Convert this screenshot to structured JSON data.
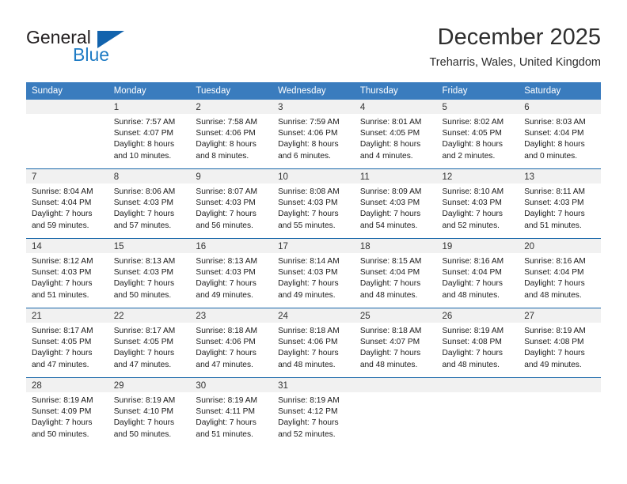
{
  "brand": {
    "name_part1": "General",
    "name_part2": "Blue",
    "accent_color": "#1263ad",
    "text_color": "#231f20"
  },
  "header": {
    "month_title": "December 2025",
    "location": "Treharris, Wales, United Kingdom"
  },
  "calendar": {
    "header_bg": "#3a7cbe",
    "daynum_bg": "#f1f1f1",
    "separator_color": "#1565a8",
    "weekdays": [
      "Sunday",
      "Monday",
      "Tuesday",
      "Wednesday",
      "Thursday",
      "Friday",
      "Saturday"
    ],
    "weeks": [
      {
        "days": [
          {
            "num": "",
            "sunrise": "",
            "sunset": "",
            "daylight_1": "",
            "daylight_2": ""
          },
          {
            "num": "1",
            "sunrise": "Sunrise: 7:57 AM",
            "sunset": "Sunset: 4:07 PM",
            "daylight_1": "Daylight: 8 hours",
            "daylight_2": "and 10 minutes."
          },
          {
            "num": "2",
            "sunrise": "Sunrise: 7:58 AM",
            "sunset": "Sunset: 4:06 PM",
            "daylight_1": "Daylight: 8 hours",
            "daylight_2": "and 8 minutes."
          },
          {
            "num": "3",
            "sunrise": "Sunrise: 7:59 AM",
            "sunset": "Sunset: 4:06 PM",
            "daylight_1": "Daylight: 8 hours",
            "daylight_2": "and 6 minutes."
          },
          {
            "num": "4",
            "sunrise": "Sunrise: 8:01 AM",
            "sunset": "Sunset: 4:05 PM",
            "daylight_1": "Daylight: 8 hours",
            "daylight_2": "and 4 minutes."
          },
          {
            "num": "5",
            "sunrise": "Sunrise: 8:02 AM",
            "sunset": "Sunset: 4:05 PM",
            "daylight_1": "Daylight: 8 hours",
            "daylight_2": "and 2 minutes."
          },
          {
            "num": "6",
            "sunrise": "Sunrise: 8:03 AM",
            "sunset": "Sunset: 4:04 PM",
            "daylight_1": "Daylight: 8 hours",
            "daylight_2": "and 0 minutes."
          }
        ]
      },
      {
        "days": [
          {
            "num": "7",
            "sunrise": "Sunrise: 8:04 AM",
            "sunset": "Sunset: 4:04 PM",
            "daylight_1": "Daylight: 7 hours",
            "daylight_2": "and 59 minutes."
          },
          {
            "num": "8",
            "sunrise": "Sunrise: 8:06 AM",
            "sunset": "Sunset: 4:03 PM",
            "daylight_1": "Daylight: 7 hours",
            "daylight_2": "and 57 minutes."
          },
          {
            "num": "9",
            "sunrise": "Sunrise: 8:07 AM",
            "sunset": "Sunset: 4:03 PM",
            "daylight_1": "Daylight: 7 hours",
            "daylight_2": "and 56 minutes."
          },
          {
            "num": "10",
            "sunrise": "Sunrise: 8:08 AM",
            "sunset": "Sunset: 4:03 PM",
            "daylight_1": "Daylight: 7 hours",
            "daylight_2": "and 55 minutes."
          },
          {
            "num": "11",
            "sunrise": "Sunrise: 8:09 AM",
            "sunset": "Sunset: 4:03 PM",
            "daylight_1": "Daylight: 7 hours",
            "daylight_2": "and 54 minutes."
          },
          {
            "num": "12",
            "sunrise": "Sunrise: 8:10 AM",
            "sunset": "Sunset: 4:03 PM",
            "daylight_1": "Daylight: 7 hours",
            "daylight_2": "and 52 minutes."
          },
          {
            "num": "13",
            "sunrise": "Sunrise: 8:11 AM",
            "sunset": "Sunset: 4:03 PM",
            "daylight_1": "Daylight: 7 hours",
            "daylight_2": "and 51 minutes."
          }
        ]
      },
      {
        "days": [
          {
            "num": "14",
            "sunrise": "Sunrise: 8:12 AM",
            "sunset": "Sunset: 4:03 PM",
            "daylight_1": "Daylight: 7 hours",
            "daylight_2": "and 51 minutes."
          },
          {
            "num": "15",
            "sunrise": "Sunrise: 8:13 AM",
            "sunset": "Sunset: 4:03 PM",
            "daylight_1": "Daylight: 7 hours",
            "daylight_2": "and 50 minutes."
          },
          {
            "num": "16",
            "sunrise": "Sunrise: 8:13 AM",
            "sunset": "Sunset: 4:03 PM",
            "daylight_1": "Daylight: 7 hours",
            "daylight_2": "and 49 minutes."
          },
          {
            "num": "17",
            "sunrise": "Sunrise: 8:14 AM",
            "sunset": "Sunset: 4:03 PM",
            "daylight_1": "Daylight: 7 hours",
            "daylight_2": "and 49 minutes."
          },
          {
            "num": "18",
            "sunrise": "Sunrise: 8:15 AM",
            "sunset": "Sunset: 4:04 PM",
            "daylight_1": "Daylight: 7 hours",
            "daylight_2": "and 48 minutes."
          },
          {
            "num": "19",
            "sunrise": "Sunrise: 8:16 AM",
            "sunset": "Sunset: 4:04 PM",
            "daylight_1": "Daylight: 7 hours",
            "daylight_2": "and 48 minutes."
          },
          {
            "num": "20",
            "sunrise": "Sunrise: 8:16 AM",
            "sunset": "Sunset: 4:04 PM",
            "daylight_1": "Daylight: 7 hours",
            "daylight_2": "and 48 minutes."
          }
        ]
      },
      {
        "days": [
          {
            "num": "21",
            "sunrise": "Sunrise: 8:17 AM",
            "sunset": "Sunset: 4:05 PM",
            "daylight_1": "Daylight: 7 hours",
            "daylight_2": "and 47 minutes."
          },
          {
            "num": "22",
            "sunrise": "Sunrise: 8:17 AM",
            "sunset": "Sunset: 4:05 PM",
            "daylight_1": "Daylight: 7 hours",
            "daylight_2": "and 47 minutes."
          },
          {
            "num": "23",
            "sunrise": "Sunrise: 8:18 AM",
            "sunset": "Sunset: 4:06 PM",
            "daylight_1": "Daylight: 7 hours",
            "daylight_2": "and 47 minutes."
          },
          {
            "num": "24",
            "sunrise": "Sunrise: 8:18 AM",
            "sunset": "Sunset: 4:06 PM",
            "daylight_1": "Daylight: 7 hours",
            "daylight_2": "and 48 minutes."
          },
          {
            "num": "25",
            "sunrise": "Sunrise: 8:18 AM",
            "sunset": "Sunset: 4:07 PM",
            "daylight_1": "Daylight: 7 hours",
            "daylight_2": "and 48 minutes."
          },
          {
            "num": "26",
            "sunrise": "Sunrise: 8:19 AM",
            "sunset": "Sunset: 4:08 PM",
            "daylight_1": "Daylight: 7 hours",
            "daylight_2": "and 48 minutes."
          },
          {
            "num": "27",
            "sunrise": "Sunrise: 8:19 AM",
            "sunset": "Sunset: 4:08 PM",
            "daylight_1": "Daylight: 7 hours",
            "daylight_2": "and 49 minutes."
          }
        ]
      },
      {
        "days": [
          {
            "num": "28",
            "sunrise": "Sunrise: 8:19 AM",
            "sunset": "Sunset: 4:09 PM",
            "daylight_1": "Daylight: 7 hours",
            "daylight_2": "and 50 minutes."
          },
          {
            "num": "29",
            "sunrise": "Sunrise: 8:19 AM",
            "sunset": "Sunset: 4:10 PM",
            "daylight_1": "Daylight: 7 hours",
            "daylight_2": "and 50 minutes."
          },
          {
            "num": "30",
            "sunrise": "Sunrise: 8:19 AM",
            "sunset": "Sunset: 4:11 PM",
            "daylight_1": "Daylight: 7 hours",
            "daylight_2": "and 51 minutes."
          },
          {
            "num": "31",
            "sunrise": "Sunrise: 8:19 AM",
            "sunset": "Sunset: 4:12 PM",
            "daylight_1": "Daylight: 7 hours",
            "daylight_2": "and 52 minutes."
          },
          {
            "num": "",
            "sunrise": "",
            "sunset": "",
            "daylight_1": "",
            "daylight_2": ""
          },
          {
            "num": "",
            "sunrise": "",
            "sunset": "",
            "daylight_1": "",
            "daylight_2": ""
          },
          {
            "num": "",
            "sunrise": "",
            "sunset": "",
            "daylight_1": "",
            "daylight_2": ""
          }
        ]
      }
    ]
  }
}
